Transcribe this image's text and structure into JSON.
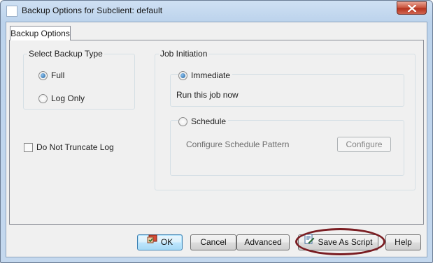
{
  "window": {
    "title": "Backup Options for Subclient: default",
    "icons": {
      "app": "app-icon",
      "close": "close-icon"
    }
  },
  "tabs": [
    {
      "label": "Backup Options",
      "active": true
    }
  ],
  "backup_type": {
    "group_title": "Select Backup Type",
    "options": [
      {
        "label": "Full",
        "selected": true
      },
      {
        "label": "Log Only",
        "selected": false
      }
    ]
  },
  "do_not_truncate_log": {
    "label": "Do Not Truncate Log",
    "checked": false
  },
  "job_initiation": {
    "group_title": "Job Initiation",
    "immediate": {
      "label": "Immediate",
      "selected": true,
      "description": "Run this job now"
    },
    "schedule": {
      "label": "Schedule",
      "selected": false,
      "pattern_label": "Configure Schedule Pattern",
      "configure_button": "Configure"
    }
  },
  "buttons": {
    "ok": "OK",
    "cancel": "Cancel",
    "advanced": "Advanced",
    "save_as_script": "Save As Script",
    "help": "Help"
  },
  "colors": {
    "highlight": "#7a1d22",
    "accent": "#3c7fb1"
  }
}
